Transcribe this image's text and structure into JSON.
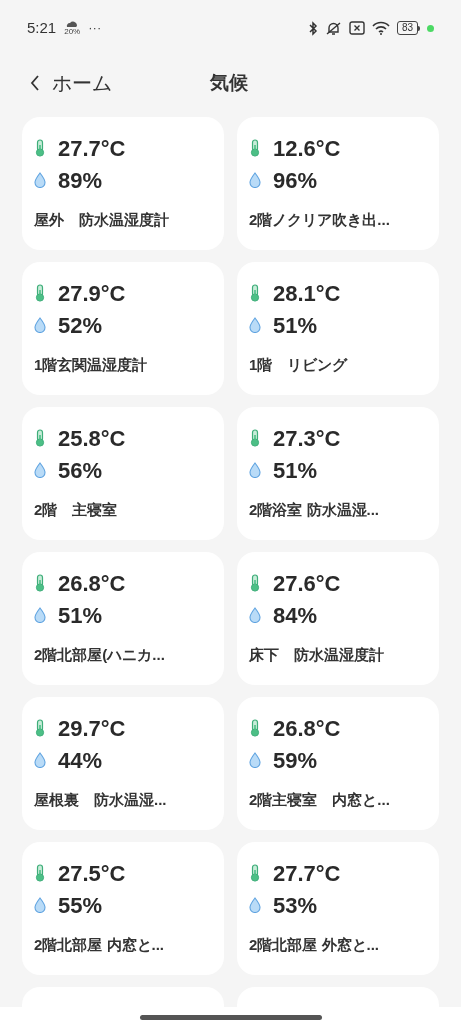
{
  "status_bar": {
    "time": "5:21",
    "weather_percent": "20%",
    "more": "···",
    "battery": "83"
  },
  "header": {
    "back_label": "ホーム",
    "title": "気候"
  },
  "sensors": [
    {
      "temperature": "27.7°C",
      "humidity": "89%",
      "name": "屋外　防水温湿度計"
    },
    {
      "temperature": "12.6°C",
      "humidity": "96%",
      "name": "2階ノクリア吹き出..."
    },
    {
      "temperature": "27.9°C",
      "humidity": "52%",
      "name": "1階玄関温湿度計"
    },
    {
      "temperature": "28.1°C",
      "humidity": "51%",
      "name": "1階　リビング"
    },
    {
      "temperature": "25.8°C",
      "humidity": "56%",
      "name": "2階　主寝室"
    },
    {
      "temperature": "27.3°C",
      "humidity": "51%",
      "name": "2階浴室 防水温湿..."
    },
    {
      "temperature": "26.8°C",
      "humidity": "51%",
      "name": "2階北部屋(ハニカ..."
    },
    {
      "temperature": "27.6°C",
      "humidity": "84%",
      "name": "床下　防水温湿度計"
    },
    {
      "temperature": "29.7°C",
      "humidity": "44%",
      "name": "屋根裏　防水温湿..."
    },
    {
      "temperature": "26.8°C",
      "humidity": "59%",
      "name": "2階主寝室　内窓と..."
    },
    {
      "temperature": "27.5°C",
      "humidity": "55%",
      "name": "2階北部屋 内窓と..."
    },
    {
      "temperature": "27.7°C",
      "humidity": "53%",
      "name": "2階北部屋 外窓と..."
    }
  ]
}
